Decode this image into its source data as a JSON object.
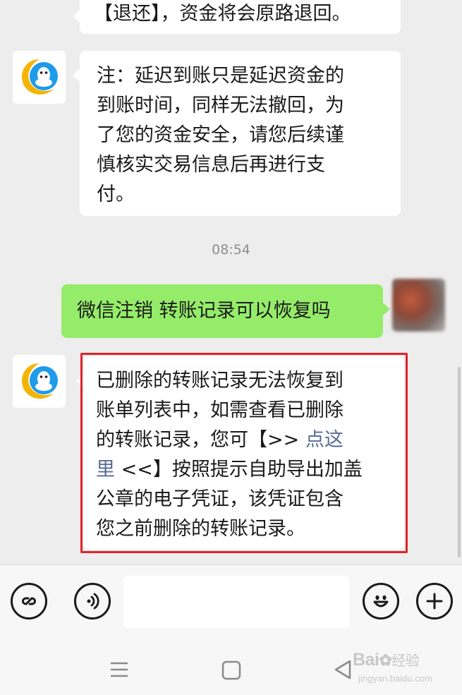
{
  "messages": {
    "m1": {
      "text": "【退还】，资金将会原路退回。"
    },
    "m2": {
      "lines": [
        "注：延迟到账只是延迟资金的",
        "到账时间，同样无法撤回，为",
        "了您的资金安全，请您后续谨",
        "慎核实交易信息后再进行支",
        "付。"
      ]
    },
    "timestamp": "08:54",
    "m3": {
      "text": "微信注销 转账记录可以恢复吗"
    },
    "m4": {
      "line1": "已删除的转账记录无法恢复到",
      "line2": "账单列表中，如需查看已删除",
      "line3_a": "的转账记录，您可【>> ",
      "line3_link": "点这",
      "line4_link": "里",
      "line4_b": " <<】按照提示自助导出加盖",
      "line5": "公章的电子凭证，该凭证包含",
      "line6": "您之前删除的转账记录。"
    }
  },
  "inputbar": {
    "mini_program_icon": "link-icon",
    "voice_icon": "voice-icon",
    "emoji_icon": "smiley-icon",
    "more_icon": "plus-icon",
    "input_value": ""
  },
  "navbar": {
    "menu_icon": "menu-icon",
    "home_icon": "home-square-icon",
    "back_icon": "back-triangle-icon"
  },
  "watermark": {
    "brand": "Bai",
    "brand_cn": "经验",
    "url": "jingyan.baidu.com"
  },
  "colors": {
    "background": "#ededed",
    "bubble_out": "#95ec69",
    "bubble_in": "#ffffff",
    "link": "#576b95",
    "highlight_border": "#e0222a"
  }
}
